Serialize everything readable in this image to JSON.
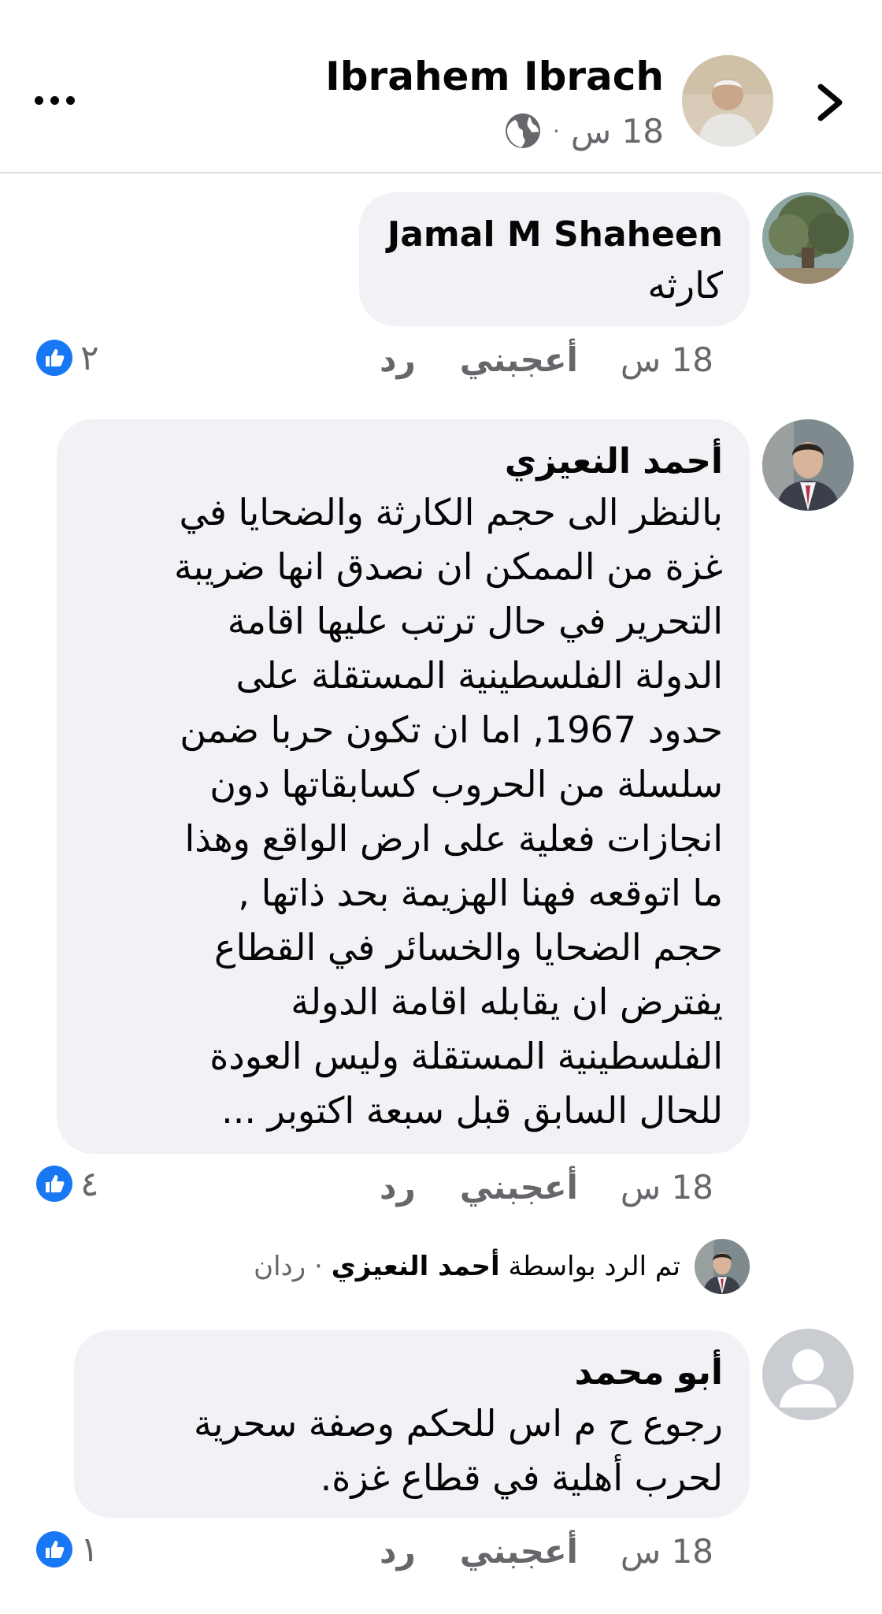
{
  "header": {
    "author_name": "Ibrahem Ibrach",
    "time": "18 س",
    "separator": "·"
  },
  "comments": [
    {
      "name": "Jamal M Shaheen",
      "lines": [
        "كارثه"
      ],
      "time": "18 س",
      "like_label": "أعجبني",
      "reply_label": "رد",
      "reaction_count": "٢"
    },
    {
      "name": "أحمد النعيزي",
      "lines": [
        "بالنظر الى حجم الكارثة والضحايا في",
        "غزة من الممكن ان نصدق انها ضريبة",
        "التحرير في حال ترتب عليها اقامة",
        "الدولة الفلسطينية المستقلة على",
        "حدود 1967, اما ان تكون حربا ضمن",
        "سلسلة من الحروب كسابقاتها دون",
        "انجازات فعلية على ارض الواقع وهذا",
        "ما اتوقعه فهنا الهزيمة بحد ذاتها ,",
        "حجم الضحايا والخسائر في القطاع",
        "يفترض ان يقابله اقامة الدولة",
        "الفلسطينية المستقلة وليس العودة",
        "للحال السابق قبل سبعة اكتوبر ..."
      ],
      "time": "18 س",
      "like_label": "أعجبني",
      "reply_label": "رد",
      "reaction_count": "٤",
      "replies": {
        "prefix": "تم الرد بواسطة",
        "replier": "أحمد النعيزي",
        "count": "· ردان"
      }
    },
    {
      "name": "أبو محمد",
      "lines": [
        "رجوع ح م اس للحكم وصفة سحرية",
        "لحرب أهلية في قطاع غزة."
      ],
      "time": "18 س",
      "like_label": "أعجبني",
      "reply_label": "رد",
      "reaction_count": "١"
    }
  ],
  "colors": {
    "bubble": "#f0f2f5",
    "meta": "#65676b",
    "like_blue": "#1877f2",
    "divider": "#dadde1"
  },
  "icons": [
    "more-icon",
    "globe-icon",
    "back-chevron-icon",
    "like-icon",
    "default-avatar-icon"
  ]
}
